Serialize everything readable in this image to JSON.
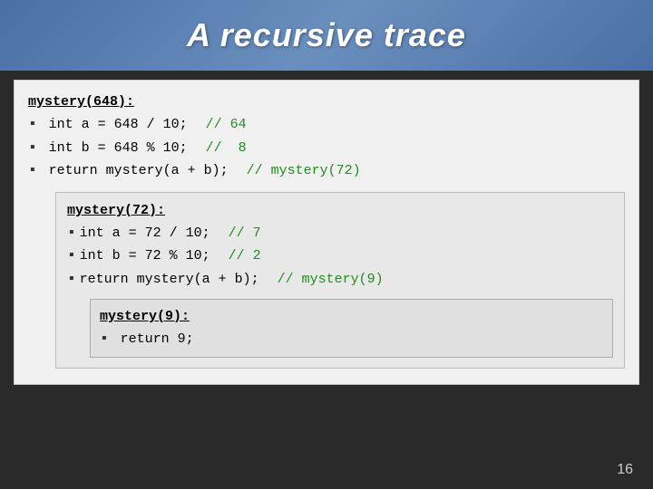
{
  "header": {
    "title": "A recursive trace"
  },
  "page_number": "16",
  "outer_call": {
    "method": "mystery(648):",
    "lines": [
      {
        "code": "int a = 648 / 10;",
        "comment": "// 64"
      },
      {
        "code": "int b = 648 % 10;",
        "comment": "//  8"
      },
      {
        "code": "return mystery(a + b);",
        "comment": "// mystery(72)"
      }
    ]
  },
  "middle_call": {
    "method": "mystery(72):",
    "lines": [
      {
        "code": "int a = 72 / 10;",
        "comment": "// 7"
      },
      {
        "code": "int b = 72 % 10;",
        "comment": "// 2"
      },
      {
        "code": "return mystery(a + b);",
        "comment": "// mystery(9)"
      }
    ]
  },
  "inner_call": {
    "method": "mystery(9):",
    "lines": [
      {
        "code": "return 9;",
        "comment": ""
      }
    ]
  }
}
